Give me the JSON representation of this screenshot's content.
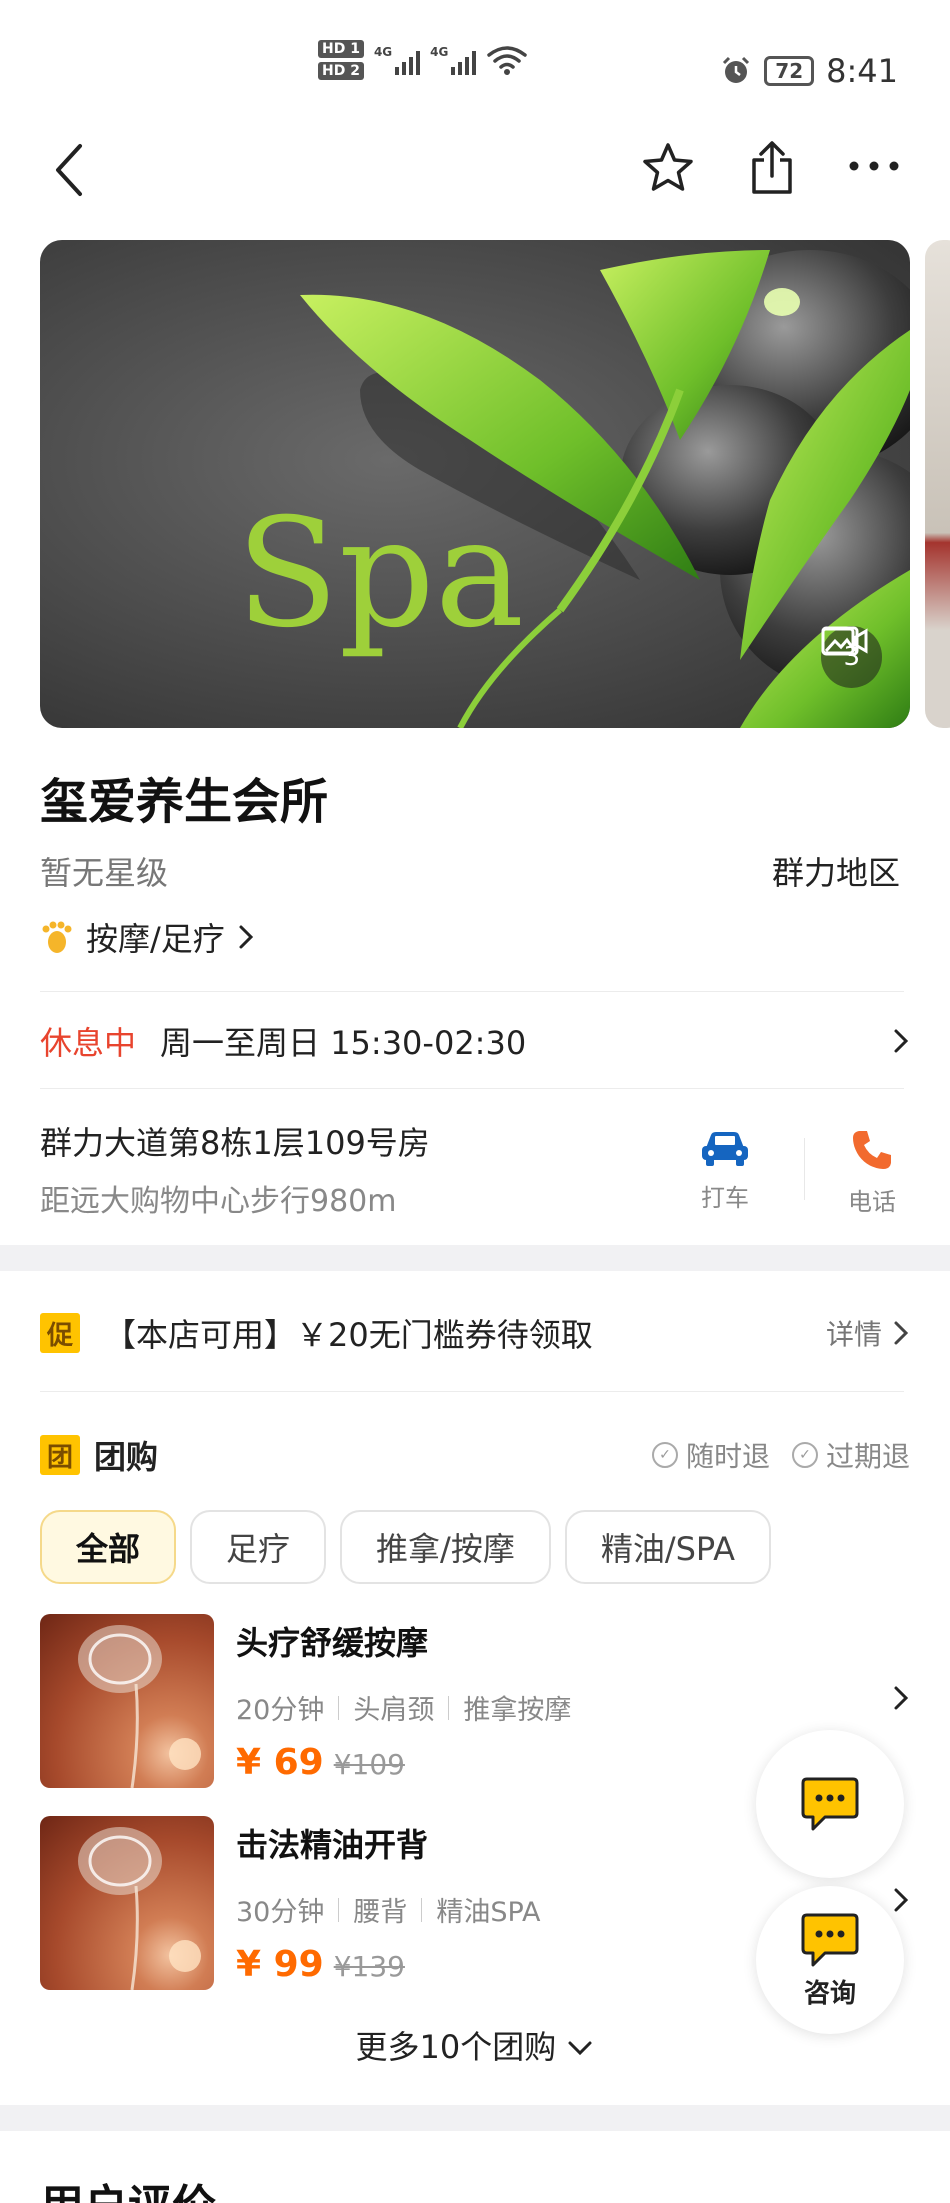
{
  "status_bar": {
    "hd1": "HD 1",
    "hd2": "HD 2",
    "net1": "4G",
    "net2": "4G",
    "battery": "72",
    "time": "8:41"
  },
  "nav": {
    "icons": [
      "back-icon",
      "star-icon",
      "share-icon",
      "more-icon"
    ]
  },
  "banner": {
    "spa_text": "Spa",
    "video_count": "3"
  },
  "shop": {
    "name": "玺爱养生会所",
    "rating": "暂无星级",
    "region": "群力地区",
    "category": "按摩/足疗",
    "hours_status": "休息中",
    "hours": "周一至周日 15:30-02:30",
    "address": "群力大道第8栋1层109号房",
    "distance": "距远大购物中心步行980m",
    "taxi_label": "打车",
    "phone_label": "电话"
  },
  "promo": {
    "tag": "促",
    "text": "【本店可用】￥20无门槛券待领取",
    "detail": "详情"
  },
  "group_buy": {
    "tag": "团",
    "title": "团购",
    "guarantee_1": "随时退",
    "guarantee_2": "过期退",
    "tabs": [
      "全部",
      "足疗",
      "推拿/按摩",
      "精油/SPA"
    ],
    "deals": [
      {
        "name": "头疗舒缓按摩",
        "tags": [
          "20分钟",
          "头肩颈",
          "推拿按摩"
        ],
        "price": "¥ 69",
        "old_price": "¥109"
      },
      {
        "name": "击法精油开背",
        "tags": [
          "30分钟",
          "腰背",
          "精油SPA"
        ],
        "price": "¥ 99",
        "old_price": "¥139"
      }
    ],
    "more": "更多10个团购"
  },
  "floating": {
    "consult_label": "咨询"
  },
  "reviews": {
    "title": "用户评价"
  },
  "colors": {
    "accent_orange": "#ff6a00",
    "closed_red": "#e8442e",
    "tag_yellow": "#ffc300",
    "taxi_blue": "#1565c0",
    "phone_orange": "#f26a2e"
  }
}
